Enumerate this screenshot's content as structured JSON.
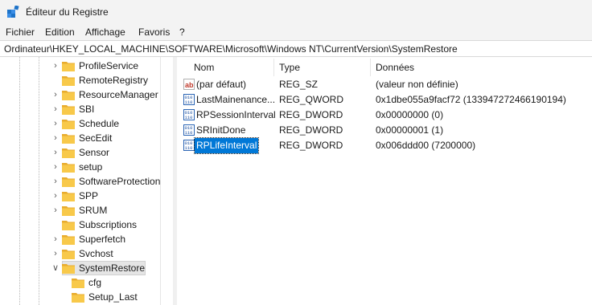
{
  "window": {
    "title": "Éditeur du Registre"
  },
  "menu": [
    "Fichier",
    "Edition",
    "Affichage",
    "Favoris",
    "?"
  ],
  "address": "Ordinateur\\HKEY_LOCAL_MACHINE\\SOFTWARE\\Microsoft\\Windows NT\\CurrentVersion\\SystemRestore",
  "tree": {
    "items": [
      {
        "label": "ProfileService",
        "expandable": true
      },
      {
        "label": "RemoteRegistry",
        "expandable": false
      },
      {
        "label": "ResourceManager",
        "expandable": true
      },
      {
        "label": "SBI",
        "expandable": true
      },
      {
        "label": "Schedule",
        "expandable": true
      },
      {
        "label": "SecEdit",
        "expandable": true
      },
      {
        "label": "Sensor",
        "expandable": true
      },
      {
        "label": "setup",
        "expandable": true
      },
      {
        "label": "SoftwareProtection",
        "expandable": true
      },
      {
        "label": "SPP",
        "expandable": true
      },
      {
        "label": "SRUM",
        "expandable": true
      },
      {
        "label": "Subscriptions",
        "expandable": false
      },
      {
        "label": "Superfetch",
        "expandable": true
      },
      {
        "label": "Svchost",
        "expandable": true
      },
      {
        "label": "SystemRestore",
        "expandable": true,
        "expanded": true,
        "selected": true
      },
      {
        "label": "cfg",
        "child": true
      },
      {
        "label": "Setup_Last",
        "child": true
      }
    ]
  },
  "list": {
    "headers": {
      "name": "Nom",
      "type": "Type",
      "data": "Données"
    },
    "rows": [
      {
        "name": "(par défaut)",
        "type": "REG_SZ",
        "data": "(valeur non définie)",
        "icon": "string-value-icon"
      },
      {
        "name": "LastMainenance...",
        "type": "REG_QWORD",
        "data": "0x1dbe055a9facf72 (133947272466190194)",
        "icon": "binary-value-icon"
      },
      {
        "name": "RPSessionInterval",
        "type": "REG_DWORD",
        "data": "0x00000000 (0)",
        "icon": "binary-value-icon"
      },
      {
        "name": "SRInitDone",
        "type": "REG_DWORD",
        "data": "0x00000001 (1)",
        "icon": "binary-value-icon"
      },
      {
        "name": "RPLifeInterval",
        "type": "REG_DWORD",
        "data": "0x006ddd00 (7200000)",
        "icon": "binary-value-icon",
        "selected": true
      }
    ]
  },
  "colors": {
    "selection": "#0078d7",
    "folder": "#f8c94a",
    "titlebar": "#f3f3f3"
  }
}
